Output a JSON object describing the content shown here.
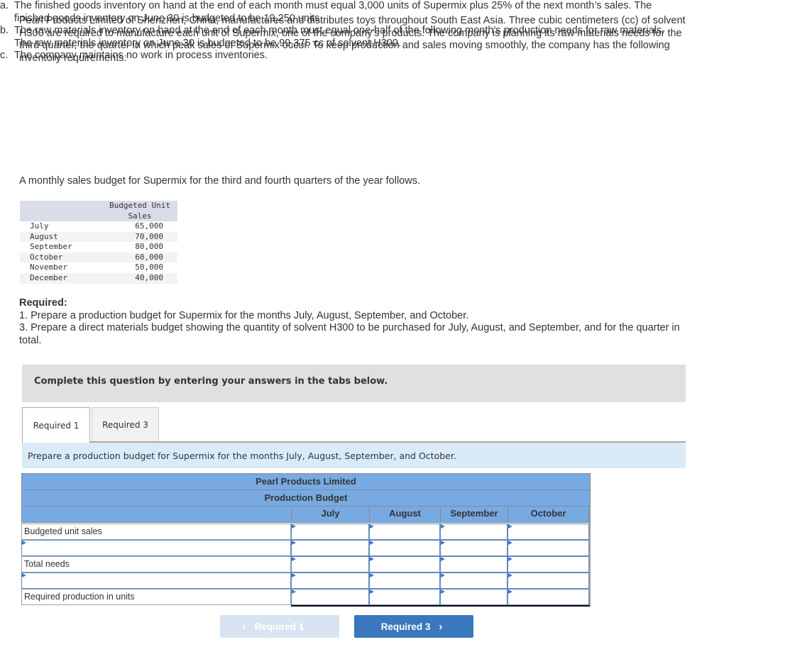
{
  "problem": {
    "intro": "Pearl Products Limited of Shenzhen, China, manufactures and distributes toys throughout South East Asia. Three cubic centimeters (cc) of solvent H300 are required to manufacture each unit of Supermix, one of the company’s products. The company is planning its raw materials needs for the third quarter, the quarter in which peak sales of Supermix occur. To keep production and sales moving smoothly, the company has the following inventory requirements:",
    "requirements": [
      {
        "marker": "a.",
        "text": "The finished goods inventory on hand at the end of each month must equal 3,000 units of Supermix plus 25% of the next month’s sales. The finished goods inventory on June 30 is budgeted to be 19,250 units."
      },
      {
        "marker": "b.",
        "text": "The raw materials inventory on hand at the end of each month must equal one-half of the following month’s production needs for raw materials. The raw materials inventory on June 30 is budgeted to be 99,375 cc of solvent H300."
      },
      {
        "marker": "c.",
        "text": "The company maintains no work in process inventories."
      }
    ],
    "sales_intro": "A monthly sales budget for Supermix for the third and fourth quarters of the year follows."
  },
  "sales_table": {
    "header": [
      "",
      "Budgeted Unit Sales"
    ],
    "rows": [
      {
        "month": "July",
        "units": "65,000"
      },
      {
        "month": "August",
        "units": "70,000"
      },
      {
        "month": "September",
        "units": "80,000"
      },
      {
        "month": "October",
        "units": "60,000"
      },
      {
        "month": "November",
        "units": "50,000"
      },
      {
        "month": "December",
        "units": "40,000"
      }
    ]
  },
  "required": {
    "title": "Required:",
    "items": [
      "1. Prepare a production budget for Supermix for the months July, August, September, and October.",
      "3. Prepare a direct materials budget showing the quantity of solvent H300 to be purchased for July, August, and September, and for the quarter in total."
    ]
  },
  "banner": "Complete this question by entering your answers in the tabs below.",
  "tabs": [
    {
      "label": "Required 1",
      "active": true
    },
    {
      "label": "Required 3",
      "active": false
    }
  ],
  "instruction": "Prepare a production budget for Supermix for the months July, August, September, and October.",
  "budget": {
    "company": "Pearl Products Limited",
    "title": "Production Budget",
    "columns": [
      "July",
      "August",
      "September",
      "October"
    ],
    "rows": [
      {
        "label": "Budgeted unit sales",
        "editable_label": false,
        "values": [
          "",
          "",
          "",
          ""
        ]
      },
      {
        "label": "",
        "editable_label": true,
        "values": [
          "",
          "",
          "",
          ""
        ]
      },
      {
        "label": "Total needs",
        "editable_label": false,
        "values": [
          "",
          "",
          "",
          ""
        ]
      },
      {
        "label": "",
        "editable_label": true,
        "values": [
          "",
          "",
          "",
          ""
        ]
      },
      {
        "label": "Required production in units",
        "editable_label": false,
        "values": [
          "",
          "",
          "",
          ""
        ]
      }
    ]
  },
  "nav": {
    "prev_label": "Required 1",
    "next_label": "Required 3",
    "prev_enabled": false,
    "next_enabled": true
  },
  "colors": {
    "header_blue": "#77aae3",
    "button_blue": "#3a78bd",
    "instruction_bg": "#d9ebf9",
    "banner_bg": "#e0e0e0"
  }
}
